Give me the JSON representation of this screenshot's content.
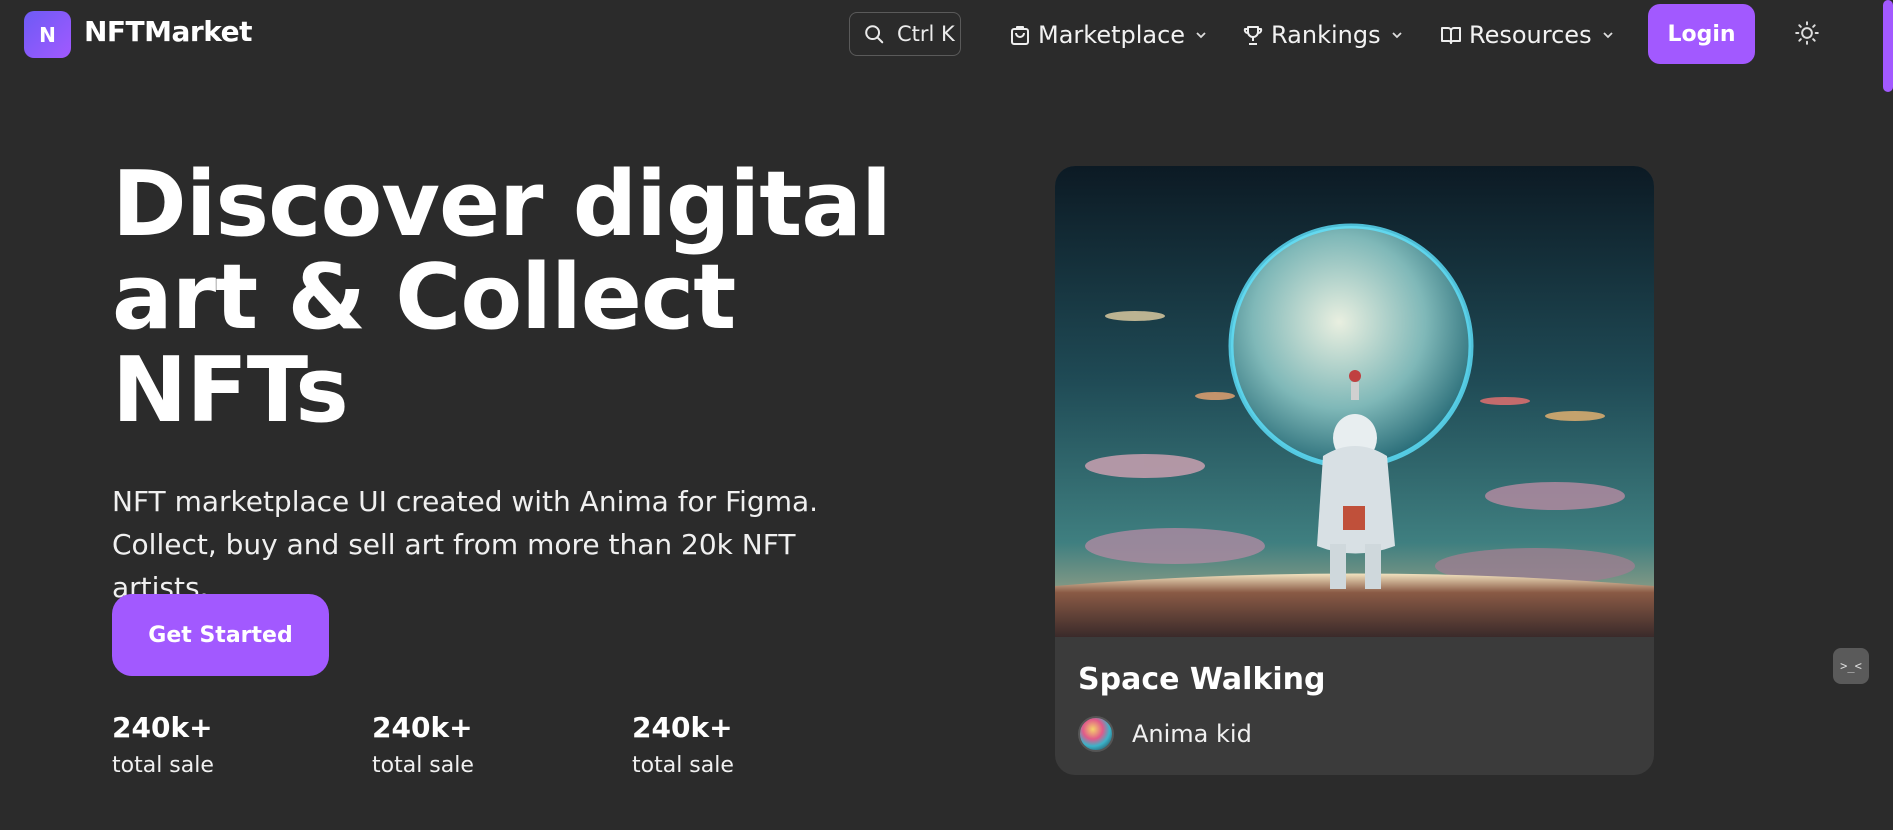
{
  "header": {
    "logo_letter": "N",
    "brand": "NFTMarket",
    "search_shortcut": "Ctrl K",
    "menu": [
      {
        "label": "Marketplace",
        "icon": "bag-icon"
      },
      {
        "label": "Rankings",
        "icon": "trophy-icon"
      },
      {
        "label": "Resources",
        "icon": "book-icon"
      }
    ],
    "login_label": "Login",
    "theme_icon": "sun-icon"
  },
  "hero": {
    "title": "Discover digital art & Collect NFTs",
    "description": "NFT marketplace UI created with Anima for Figma. Collect, buy and sell art from more than 20k NFT artists.",
    "cta_label": "Get Started",
    "stats": [
      {
        "value": "240k+",
        "label": "total sale"
      },
      {
        "value": "240k+",
        "label": "total sale"
      },
      {
        "value": "240k+",
        "label": "total sale"
      }
    ]
  },
  "featured": {
    "title": "Space Walking",
    "artist": "Anima kid"
  },
  "helper_widget": {
    "glyph": ">_<"
  },
  "colors": {
    "background": "#2b2b2b",
    "accent": "#a259ff",
    "card": "#3b3b3b"
  }
}
